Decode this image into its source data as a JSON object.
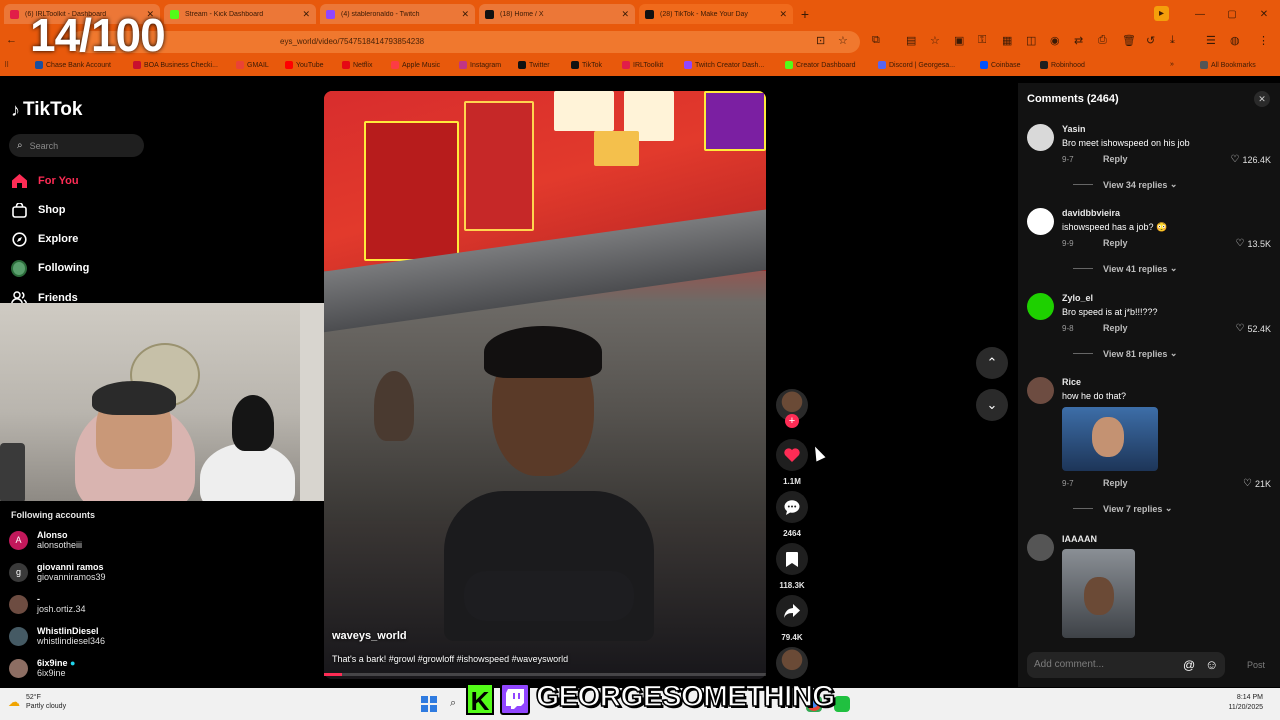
{
  "overlay": {
    "counter": "14/100",
    "banner": "GEORGESOMETHING"
  },
  "browser": {
    "tabs": [
      {
        "label": "(6) IRLToolkit - Dashboard",
        "color": "#e11d48"
      },
      {
        "label": "Stream - Kick Dashboard",
        "color": "#53fc18"
      },
      {
        "label": "(4) stableronaldo - Twitch",
        "color": "#9146ff"
      },
      {
        "label": "(18) Home / X",
        "color": "#111111"
      },
      {
        "label": "(28) TikTok - Make Your Day",
        "color": "#111111"
      }
    ],
    "address": "eys_world/video/754751841479385423​8",
    "bookmarks": [
      {
        "label": "Chase Bank Account",
        "color": "#1a4fa0"
      },
      {
        "label": "BOA Business Checki...",
        "color": "#c8102e"
      },
      {
        "label": "GMAIL",
        "color": "#ea4335"
      },
      {
        "label": "YouTube",
        "color": "#ff0000"
      },
      {
        "label": "Netflix",
        "color": "#e50914"
      },
      {
        "label": "Apple Music",
        "color": "#fc3c44"
      },
      {
        "label": "Instagram",
        "color": "#c13584"
      },
      {
        "label": "Twitter",
        "color": "#111111"
      },
      {
        "label": "TikTok",
        "color": "#111111"
      },
      {
        "label": "IRLToolkit",
        "color": "#e11d48"
      },
      {
        "label": "Twitch Creator Dash...",
        "color": "#9146ff"
      },
      {
        "label": "Creator Dashboard",
        "color": "#53fc18"
      },
      {
        "label": "Discord | Georgesa...",
        "color": "#5865f2"
      },
      {
        "label": "Coinbase",
        "color": "#0052ff"
      },
      {
        "label": "Robinhood",
        "color": "#1f1f1f"
      },
      {
        "label": "All Bookmarks",
        "color": "#555555"
      }
    ]
  },
  "tiktok": {
    "logo": "TikTok",
    "search_placeholder": "Search",
    "nav": {
      "foryou": "For You",
      "shop": "Shop",
      "explore": "Explore",
      "following": "Following",
      "friends": "Friends"
    },
    "following_title": "Following accounts",
    "following": [
      {
        "name": "Alonso",
        "handle": "alonsotheiii",
        "initial": "A",
        "color": "#c2185b"
      },
      {
        "name": "giovanni ramos",
        "handle": "giovanniramos39",
        "initial": "g",
        "color": "#3a3a3a"
      },
      {
        "name": "-",
        "handle": "josh.ortiz.34",
        "initial": "",
        "color": "#6d4c41"
      },
      {
        "name": "WhistlinDiesel",
        "handle": "whistlindiesel346",
        "initial": "",
        "color": "#455a64"
      },
      {
        "name": "6ix9ine",
        "handle": "6ix9ine",
        "initial": "",
        "color": "#8d6e63"
      }
    ],
    "video": {
      "author": "waveys_world",
      "caption": "That's a bark! #growl #growloff #ishowspeed #waveysworld",
      "progress": 0.04
    },
    "actions": {
      "likes": "1.1M",
      "comments": "2464",
      "saves": "118.3K",
      "shares": "79.4K"
    },
    "comments_title": "Comments (2464)",
    "comments": [
      {
        "user": "Yasin",
        "text": "Bro meet ishowspeed on his job",
        "date": "9-7",
        "reply": "Reply",
        "likes": "126.4K",
        "view": "View 34 replies",
        "avatar": "#d9d9d9"
      },
      {
        "user": "davidbbvieira",
        "text": "ishowspeed has a job? 😳",
        "date": "9-9",
        "reply": "Reply",
        "likes": "13.5K",
        "view": "View 41 replies",
        "avatar": "#ffffff"
      },
      {
        "user": "Zylo_el",
        "text": "Bro speed is at j*b!!!???",
        "date": "9-8",
        "reply": "Reply",
        "likes": "52.4K",
        "view": "View 81 replies",
        "avatar": "#1ed000"
      },
      {
        "user": "Rice",
        "text": "how he do that?",
        "date": "9-7",
        "reply": "Reply",
        "likes": "21K",
        "view": "View 7 replies",
        "avatar": "#6d4c41"
      },
      {
        "user": "IAAAAN",
        "text": "",
        "avatar": "#555555"
      }
    ],
    "add_comment_placeholder": "Add comment...",
    "post": "Post"
  },
  "taskbar": {
    "temp": "52°F",
    "weather": "Partly cloudy",
    "time": "8:14 PM",
    "date": "11/20/2025"
  }
}
